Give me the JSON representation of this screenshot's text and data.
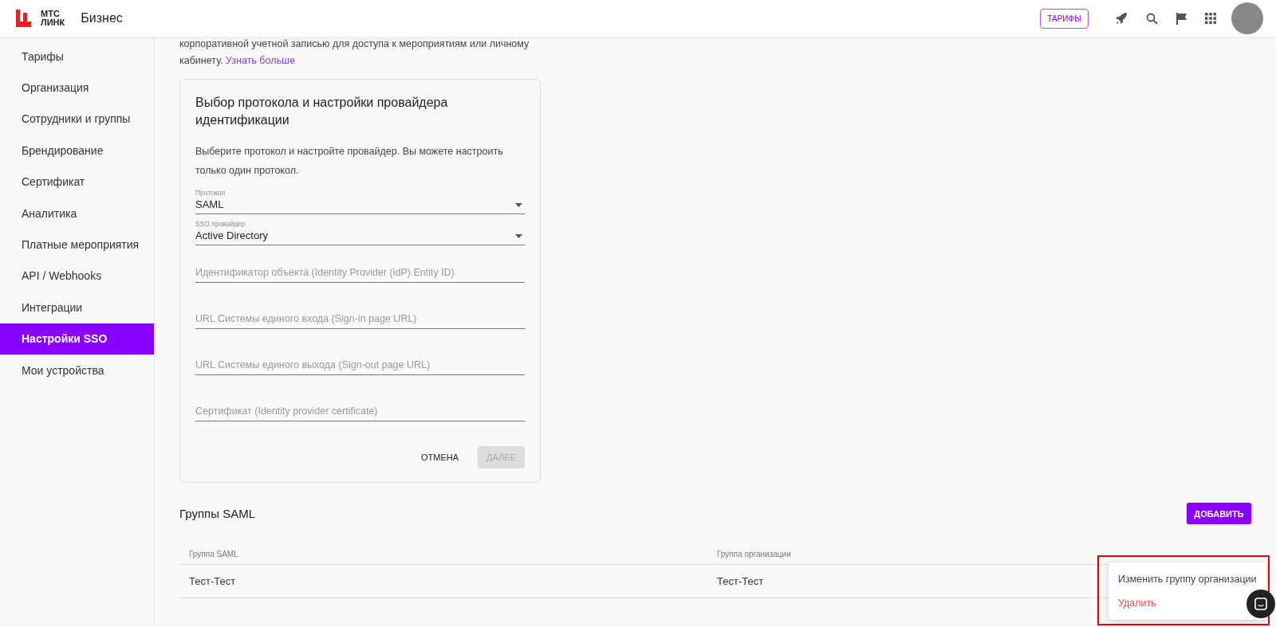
{
  "header": {
    "logo_line1": "МТС",
    "logo_line2": "ЛИНК",
    "product": "Бизнес",
    "tariffs_button": "ТАРИФЫ"
  },
  "sidebar": {
    "items": [
      {
        "label": "Тарифы",
        "selected": false
      },
      {
        "label": "Организация",
        "selected": false
      },
      {
        "label": "Сотрудники и группы",
        "selected": false
      },
      {
        "label": "Брендирование",
        "selected": false
      },
      {
        "label": "Сертификат",
        "selected": false
      },
      {
        "label": "Аналитика",
        "selected": false
      },
      {
        "label": "Платные мероприятия",
        "selected": false
      },
      {
        "label": "API / Webhooks",
        "selected": false
      },
      {
        "label": "Интеграции",
        "selected": false
      },
      {
        "label": "Настройки SSO",
        "selected": true
      },
      {
        "label": "Мои устройства",
        "selected": false
      }
    ]
  },
  "intro": {
    "text": "корпоративной учетной записью для доступа к мероприятиям или личному кабинету.",
    "link": "Узнать больше"
  },
  "card": {
    "title": "Выбор протокола и настройки провайдера идентификации",
    "description": "Выберите протокол и настройте провайдер. Вы можете настроить только один протокол.",
    "fields": [
      {
        "kind": "select",
        "label": "Протокол",
        "value": "SAML"
      },
      {
        "kind": "select",
        "label": "SSO провайдер",
        "value": "Active Directory"
      },
      {
        "kind": "text",
        "placeholder": "Идентификатор объекта (Identity Provider (idP) Entity ID)"
      },
      {
        "kind": "text",
        "placeholder": "URL Системы единого входа (Sign-in page URL)"
      },
      {
        "kind": "text",
        "placeholder": "URL Системы единого выхода (Sign-out page URL)"
      },
      {
        "kind": "text",
        "placeholder": "Сертификат (Identity provider certificate)"
      }
    ],
    "cancel_button": "ОТМЕНА",
    "next_button": {
      "label": "ДАЛЕЕ",
      "disabled": true
    }
  },
  "groups": {
    "title": "Группы SAML",
    "add_button": "ДОБАВИТЬ",
    "table": {
      "columns": [
        "Группа SAML",
        "Группа организации"
      ],
      "rows": [
        [
          "Тест-Тест",
          "Тест-Тест"
        ]
      ]
    },
    "context_menu": [
      {
        "kind": "normal",
        "label": "Изменить группу организации"
      },
      {
        "kind": "danger",
        "label": "Удалить"
      }
    ]
  }
}
